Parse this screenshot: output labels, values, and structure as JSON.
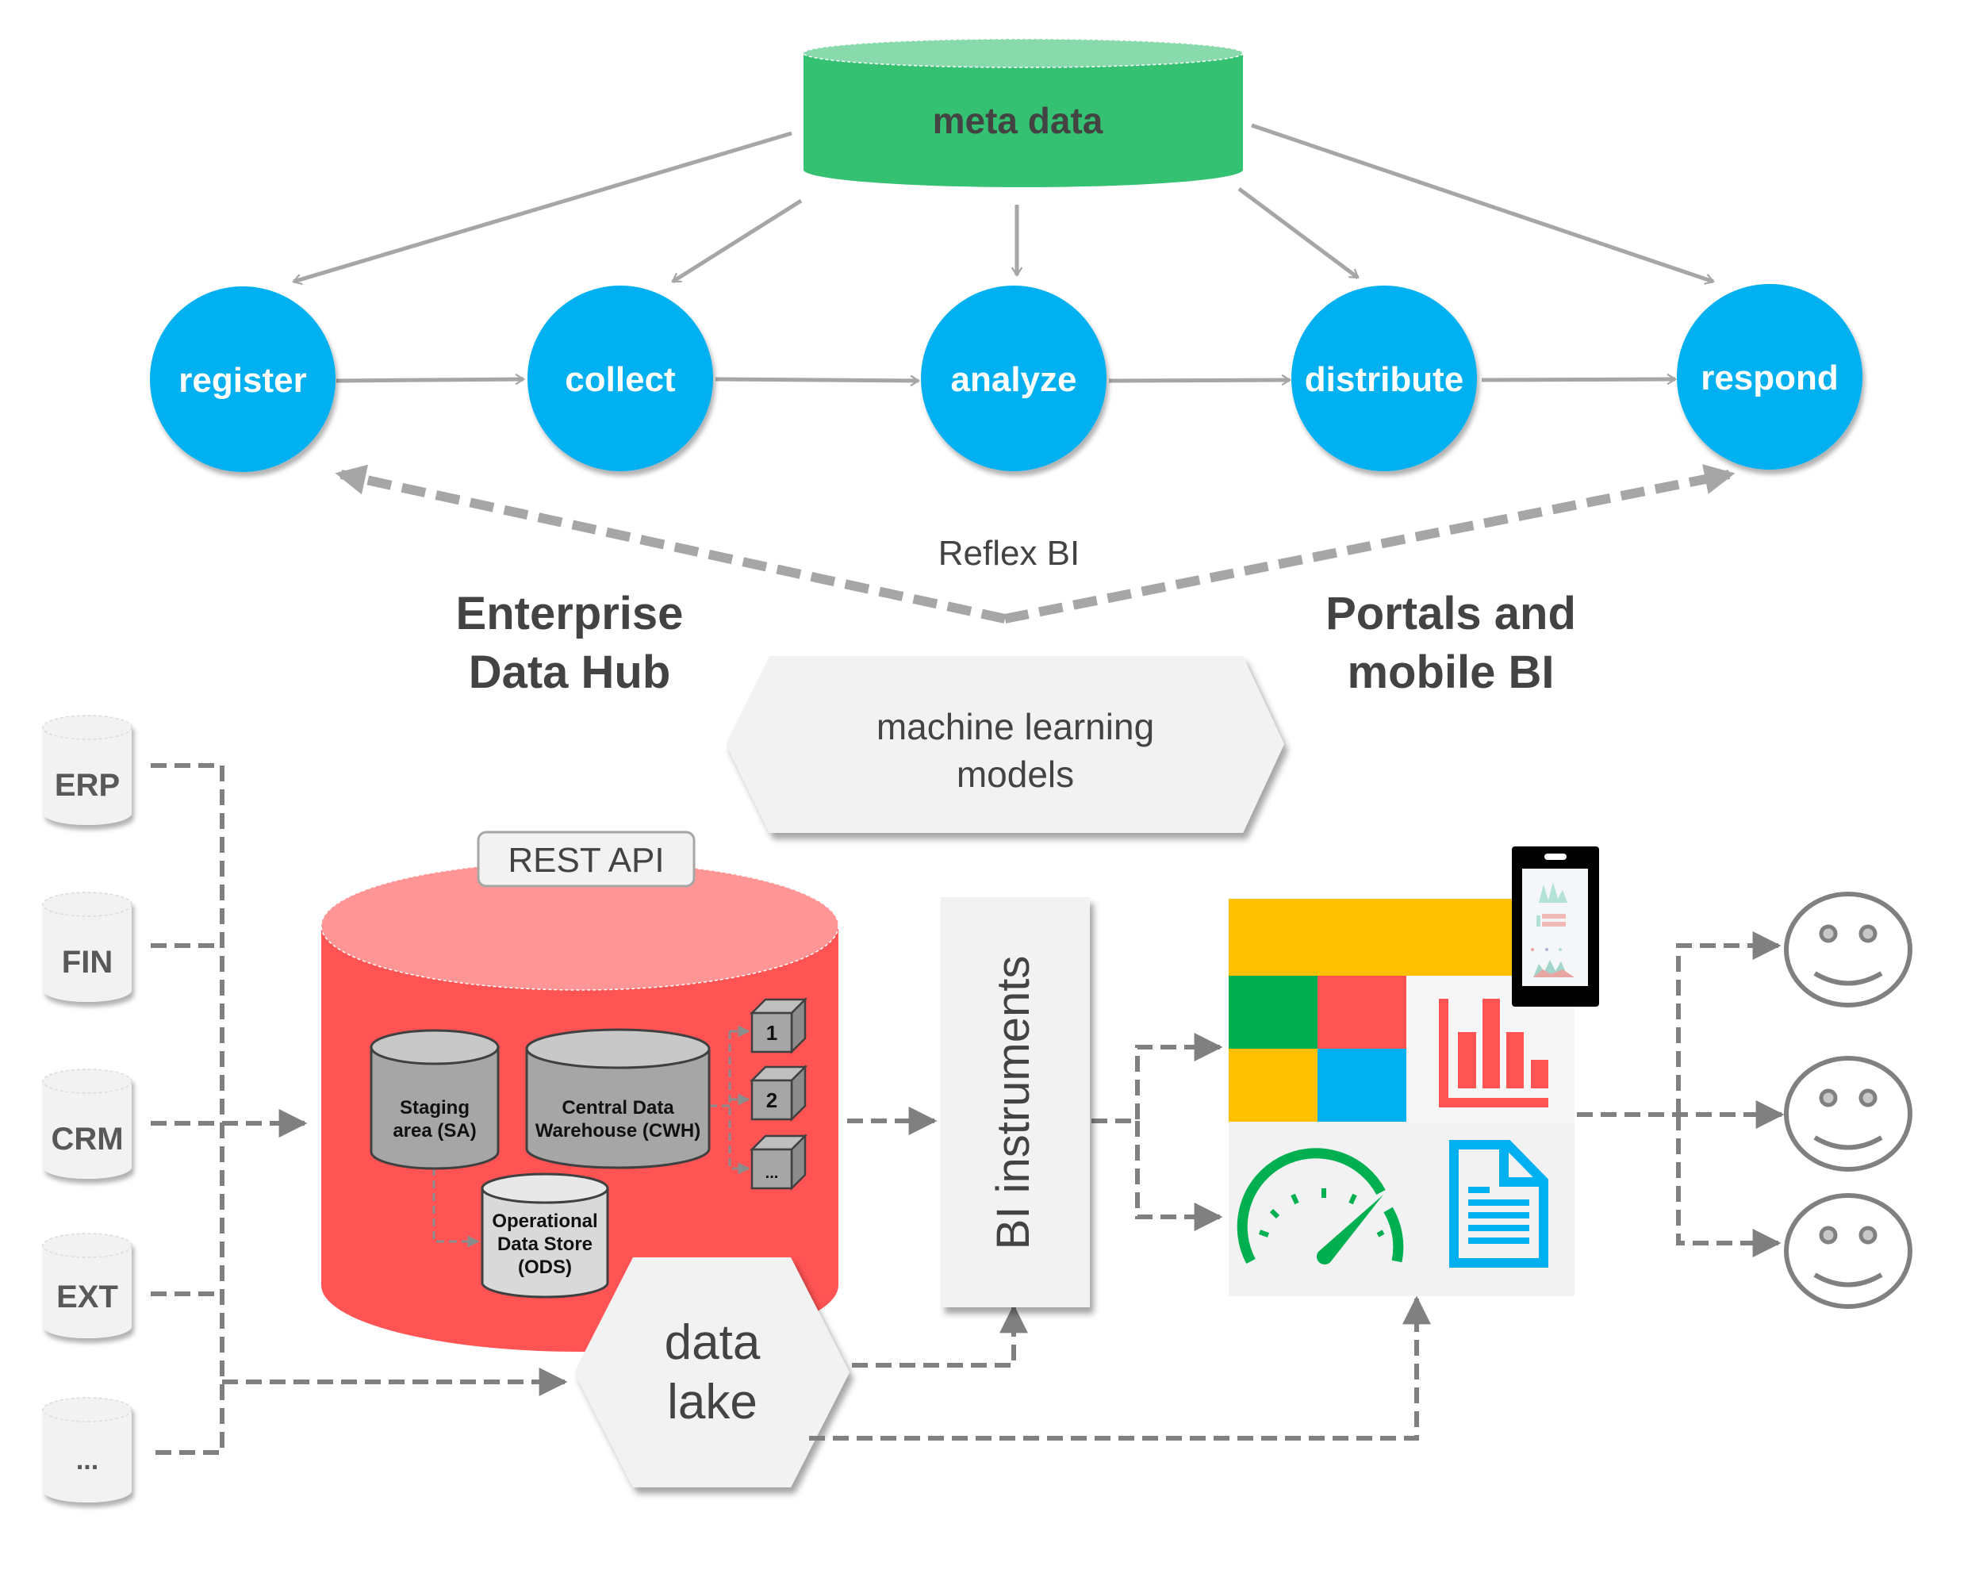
{
  "colors": {
    "process_node": "#00b0f0",
    "meta_body": "#35c172",
    "meta_top": "#88d9ab",
    "edh_body": "#ff5354",
    "edh_top": "#ff9595",
    "panel_gray": "#f2f2f2",
    "tile_yellow": "#ffc000",
    "tile_green": "#00b050",
    "tile_red": "#ff5354",
    "tile_blue": "#00b0f0",
    "text_dark": "#434343",
    "connector": "#808080"
  },
  "metadata": {
    "label": "meta data"
  },
  "process_flow": [
    {
      "id": "register",
      "label": "register"
    },
    {
      "id": "collect",
      "label": "collect"
    },
    {
      "id": "analyze",
      "label": "analyze"
    },
    {
      "id": "distribute",
      "label": "distribute"
    },
    {
      "id": "respond",
      "label": "respond"
    }
  ],
  "reflex": {
    "label": "Reflex BI"
  },
  "sections": {
    "edh_title": [
      "Enterprise",
      "Data Hub"
    ],
    "portals_title": [
      "Portals and",
      "mobile BI"
    ]
  },
  "ml_models": {
    "lines": [
      "machine learning",
      "models"
    ]
  },
  "sources": [
    {
      "id": "erp",
      "label": "ERP"
    },
    {
      "id": "fin",
      "label": "FIN"
    },
    {
      "id": "crm",
      "label": "CRM"
    },
    {
      "id": "ext",
      "label": "EXT"
    },
    {
      "id": "more",
      "label": "..."
    }
  ],
  "edh": {
    "rest_api": "REST API",
    "staging": [
      "Staging",
      "area (SA)"
    ],
    "cwh": [
      "Central Data",
      "Warehouse (CWH)"
    ],
    "ods": [
      "Operational",
      "Data Store",
      "(ODS)"
    ],
    "marts": [
      "1",
      "2",
      "..."
    ]
  },
  "data_lake": {
    "lines": [
      "data",
      "lake"
    ]
  },
  "bi_instruments": {
    "label": "BI instruments"
  },
  "portal": {
    "icons": [
      "bar-chart-icon",
      "gauge-icon",
      "document-icon",
      "mobile-phone-icon"
    ]
  },
  "consumers": [
    {
      "id": "user-1",
      "icon": "smiley-icon"
    },
    {
      "id": "user-2",
      "icon": "smiley-icon"
    },
    {
      "id": "user-3",
      "icon": "smiley-icon"
    }
  ]
}
